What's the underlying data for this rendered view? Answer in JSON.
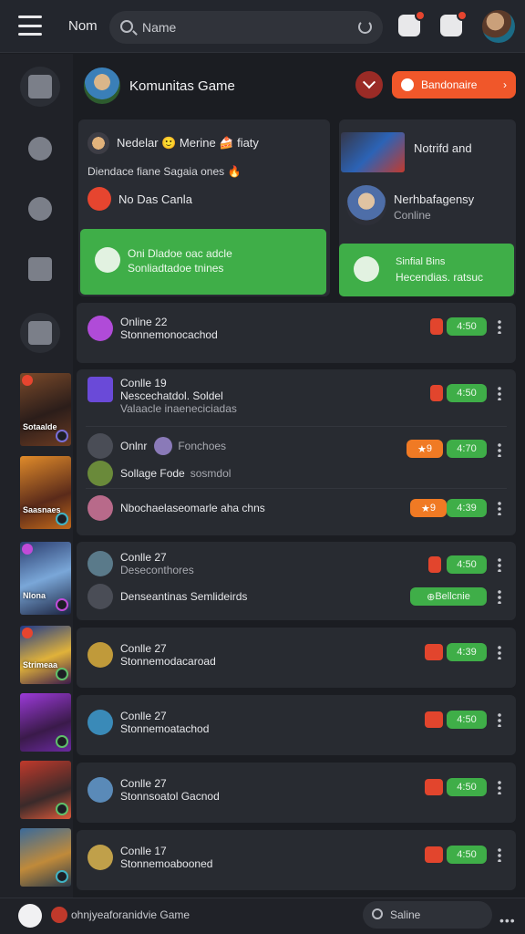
{
  "topbar": {
    "label": "Nom",
    "search_text": "Name"
  },
  "header": {
    "title": "Komunitas Game",
    "cta_label": "Bandonaire"
  },
  "card_left": {
    "line1": "Nedelar 🙂 Merine 🍰 fiaty",
    "line2": "Diendace fiane Sagaia ones 🔥",
    "line3": "No Das Canla",
    "green_line1": "Oni Dladoe oac adcle",
    "green_line2": "Sonliadtadoe tnines"
  },
  "card_right": {
    "top_label": "Notrifd and",
    "user_name": "Nerhbafagensy",
    "user_status": "Conline",
    "green_line1": "Sinfial Bins",
    "green_line2": "Hecendias. ratsuc"
  },
  "rows": [
    {
      "title": "Online 22",
      "sub": "Stonnemonocachod",
      "time": "4:50"
    },
    {
      "title": "Conlle 19",
      "sub": "Nescechatdol. Soldel",
      "extra": "Valaacle inaeneciciadas",
      "time": "4:50"
    },
    {
      "title": "Onlnr",
      "sub": "Fonchoes",
      "time": "4:70",
      "star": "9"
    },
    {
      "title": "Sollage Fode",
      "sub": "sosmdol"
    },
    {
      "title": "Nbochaelaseomarle aha chns",
      "time": "4:39",
      "star": "9"
    },
    {
      "title": "Conlle 27",
      "sub": "Deseconthores",
      "time": "4:50"
    },
    {
      "title": "Denseantinas Semlideirds",
      "badge": "Bellcnie"
    },
    {
      "title": "Conlle 27",
      "sub": "Stonnemodacaroad",
      "time": "4:39"
    },
    {
      "title": "Conlle 27",
      "sub": "Stonnemoatachod",
      "time": "4:50"
    },
    {
      "title": "Conlle 27",
      "sub": "Stonnsoatol Gacnod",
      "time": "4:50"
    },
    {
      "title": "Conlle 17",
      "sub": "Stonnemoabooned",
      "time": "4:50"
    }
  ],
  "thumbs": [
    "Sotaalde",
    "Saasnaes",
    "Nlona",
    "Strimeaa",
    "",
    "",
    ""
  ],
  "bottombar": {
    "label": "ohnjyeaforanidvie Game",
    "search_text": "Saline"
  },
  "colors": {
    "bg": "#1b1d22",
    "card": "#282b31",
    "accent_orange": "#f0572a",
    "accent_green": "#3fae48",
    "accent_red": "#e2452d"
  }
}
